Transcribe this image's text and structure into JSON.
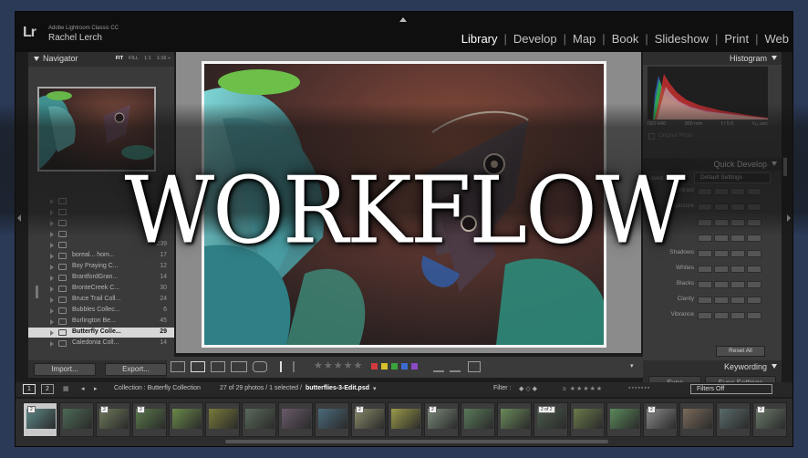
{
  "app": {
    "logo": "Lr",
    "product_name": "Adobe Lightroom Classic CC",
    "user_name": "Rachel Lerch"
  },
  "modules": [
    {
      "label": "Library",
      "active": true
    },
    {
      "label": "Develop",
      "active": false
    },
    {
      "label": "Map",
      "active": false
    },
    {
      "label": "Book",
      "active": false
    },
    {
      "label": "Slideshow",
      "active": false
    },
    {
      "label": "Print",
      "active": false
    },
    {
      "label": "Web",
      "active": false
    }
  ],
  "navigator": {
    "title": "Navigator",
    "zoom_options": [
      {
        "label": "FIT",
        "active": true
      },
      {
        "label": "FILL",
        "active": false
      },
      {
        "label": "1:1",
        "active": false
      },
      {
        "label": "1:16 ÷",
        "active": false
      }
    ]
  },
  "collections": [
    {
      "name": "",
      "count": "",
      "selected": false
    },
    {
      "name": "",
      "count": "",
      "selected": false
    },
    {
      "name": "",
      "count": "",
      "selected": false
    },
    {
      "name": "",
      "count": "",
      "selected": false
    },
    {
      "name": "",
      "count": "239",
      "selected": false
    },
    {
      "name": "boreal... hom...",
      "count": "17",
      "selected": false
    },
    {
      "name": "Boy Praying C...",
      "count": "12",
      "selected": false
    },
    {
      "name": "BrantfordGran...",
      "count": "14",
      "selected": false
    },
    {
      "name": "BronteCreek C...",
      "count": "30",
      "selected": false
    },
    {
      "name": "Bruce Trail Coll...",
      "count": "24",
      "selected": false
    },
    {
      "name": "Bubbles Collec...",
      "count": "6",
      "selected": false
    },
    {
      "name": "Burlington Be...",
      "count": "45",
      "selected": false
    },
    {
      "name": "Butterfly Colle...",
      "count": "29",
      "selected": true
    },
    {
      "name": "Caledonia Coll...",
      "count": "14",
      "selected": false
    }
  ],
  "left_buttons": {
    "import": "Import...",
    "export": "Export..."
  },
  "histogram": {
    "title": "Histogram",
    "iso": "ISO 640",
    "focal": "300 mm",
    "aperture": "f / 5.6",
    "shutter": "¹⁄₄₀ sec",
    "original_photo": "Original Photo"
  },
  "quick_develop": {
    "title": "Quick Develop",
    "saved_preset_label": "Saved Preset",
    "saved_preset_value": "Default Settings",
    "rows": [
      "Contrast",
      "Exposure",
      "",
      "",
      "Shadows",
      "Whites",
      "Blacks",
      "Clarity",
      "Vibrance"
    ],
    "reset_all": "Reset All"
  },
  "keywording": {
    "title": "Keywording"
  },
  "sync": {
    "sync": "Sync",
    "sync_settings": "Sync Settings"
  },
  "filmstrip_bar": {
    "page1": "1",
    "page2": "2",
    "collection": "Collection : Butterfly Collection",
    "count": "27 of 29 photos / 1 selected /",
    "filename": "butterflies-3-Edit.psd",
    "filter_label": "Filter :",
    "filters_off": "Filters Off"
  },
  "filmstrip": {
    "thumbnails": [
      {
        "badge": "2",
        "selected": true,
        "color": "#5e8a8a"
      },
      {
        "badge": "",
        "selected": false,
        "color": "#4d6a55"
      },
      {
        "badge": "2",
        "selected": false,
        "color": "#6e7a5a"
      },
      {
        "badge": "2",
        "selected": false,
        "color": "#5a7a4a"
      },
      {
        "badge": "",
        "selected": false,
        "color": "#6a8a4a"
      },
      {
        "badge": "",
        "selected": false,
        "color": "#7a7a3a"
      },
      {
        "badge": "",
        "selected": false,
        "color": "#5a6a5a"
      },
      {
        "badge": "",
        "selected": false,
        "color": "#6a5a6a"
      },
      {
        "badge": "",
        "selected": false,
        "color": "#4a6a7a"
      },
      {
        "badge": "2",
        "selected": false,
        "color": "#8a8a6a"
      },
      {
        "badge": "",
        "selected": false,
        "color": "#9a9a4a"
      },
      {
        "badge": "2",
        "selected": false,
        "color": "#7a8a7a"
      },
      {
        "badge": "",
        "selected": false,
        "color": "#5a7a5a"
      },
      {
        "badge": "",
        "selected": false,
        "color": "#6a8a5a"
      },
      {
        "badge": "2 of 2",
        "selected": false,
        "color": "#4a5a4a"
      },
      {
        "badge": "",
        "selected": false,
        "color": "#6a7a4a"
      },
      {
        "badge": "",
        "selected": false,
        "color": "#5a8a5a"
      },
      {
        "badge": "2",
        "selected": false,
        "color": "#8a8a8a"
      },
      {
        "badge": "",
        "selected": false,
        "color": "#7a6a5a"
      },
      {
        "badge": "",
        "selected": false,
        "color": "#5a6a6a"
      },
      {
        "badge": "2",
        "selected": false,
        "color": "#6a7a6a"
      }
    ]
  },
  "overlay": {
    "title": "WORKFLOW"
  },
  "colors": {
    "label_red": "#d13b3b",
    "label_yellow": "#d6c12d",
    "label_green": "#3ba33b",
    "label_blue": "#3b6bd1",
    "label_purple": "#8a4bc4"
  }
}
